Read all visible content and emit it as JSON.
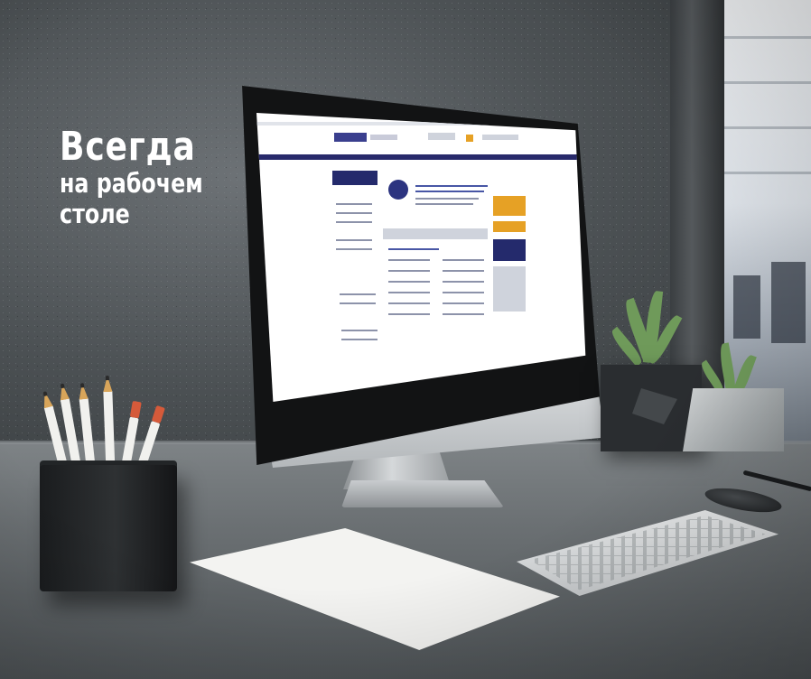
{
  "headline": {
    "line1": "Всегда",
    "line2": "на рабочем",
    "line3": "столе"
  },
  "scene": {
    "items": [
      "imac-monitor",
      "pencil-cup",
      "succulent-pot",
      "concrete-planter",
      "keyboard",
      "mouse",
      "magazine-on-tablet",
      "pen",
      "window"
    ]
  },
  "colors": {
    "wall": "#4c5154",
    "desk": "#6b7073",
    "site_navbar": "#282a6b",
    "site_accent": "#e6a125",
    "headline_text": "#ffffff"
  }
}
